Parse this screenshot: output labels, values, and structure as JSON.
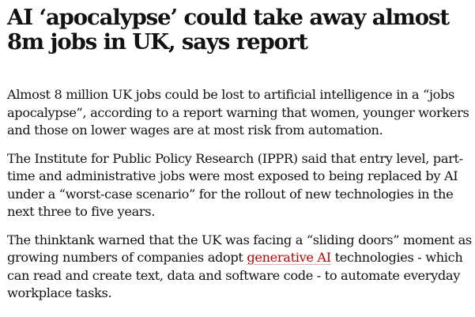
{
  "article": {
    "headline": "AI ‘apocalypse’ could take away almost 8m jobs in UK, says report",
    "paragraphs": {
      "p1": "Almost 8 million UK jobs could be lost to artificial intelligence in a “jobs apocalypse”, according to a report warning that women, younger workers and those on lower wages are at most risk from automation.",
      "p2": "The Institute for Public Policy Research (IPPR) said that entry level, part-time and administrative jobs were most exposed to being replaced by AI under a “worst-case scenario” for the rollout of new technologies in the next three to five years.",
      "p3": {
        "before_link": "The thinktank warned that the UK was facing a “sliding doors” moment as growing numbers of companies adopt ",
        "link_text": "generative AI",
        "after_link": " technologies - which can read and create text, data and software code - to automate everyday workplace tasks."
      }
    }
  },
  "colors": {
    "text": "#121212",
    "link": "#c70000",
    "background": "#ffffff"
  }
}
